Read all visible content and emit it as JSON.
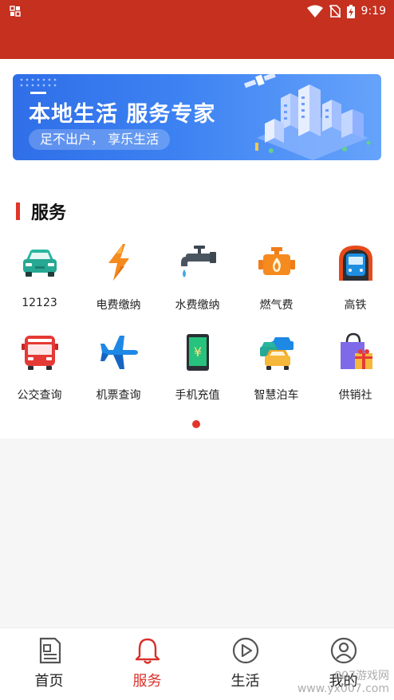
{
  "status_bar": {
    "time": "9:19",
    "icons": [
      "wifi-icon",
      "no-sim-icon",
      "battery-charging-icon"
    ]
  },
  "banner": {
    "title": "本地生活  服务专家",
    "subtitle": "足不出户，  享乐生活"
  },
  "section": {
    "title": "服务"
  },
  "services": [
    {
      "label": "12123",
      "icon": "car-icon"
    },
    {
      "label": "电费缴纳",
      "icon": "lightning-icon"
    },
    {
      "label": "水费缴纳",
      "icon": "water-tap-icon"
    },
    {
      "label": "燃气费",
      "icon": "gas-engine-icon"
    },
    {
      "label": "高铁",
      "icon": "train-icon"
    },
    {
      "label": "公交查询",
      "icon": "bus-icon"
    },
    {
      "label": "机票查询",
      "icon": "airplane-icon"
    },
    {
      "label": "手机充值",
      "icon": "phone-recharge-icon"
    },
    {
      "label": "智慧泊车",
      "icon": "parking-cars-icon"
    },
    {
      "label": "供销社",
      "icon": "shopping-bag-icon"
    }
  ],
  "pager": {
    "active_index": 0,
    "page_count": 1
  },
  "bottom_nav": [
    {
      "label": "首页",
      "icon": "newspaper-icon",
      "active": false
    },
    {
      "label": "服务",
      "icon": "bell-icon",
      "active": true
    },
    {
      "label": "生活",
      "icon": "play-icon",
      "active": false
    },
    {
      "label": "我的",
      "icon": "user-icon",
      "active": false
    }
  ],
  "watermark": {
    "line1": "007游戏网",
    "line2": "www.yx007.com"
  },
  "colors": {
    "brand_red": "#c5301f",
    "accent_red": "#d9302a",
    "banner_blue": "#3d82f2"
  }
}
